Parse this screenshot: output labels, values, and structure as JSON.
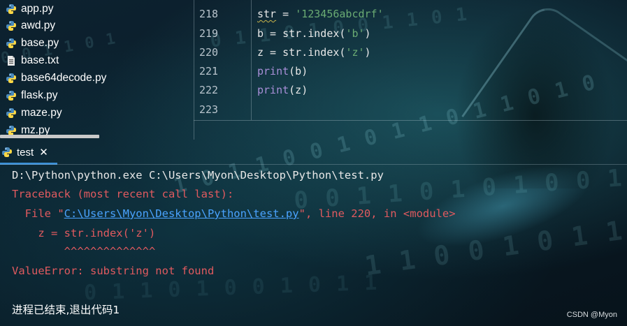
{
  "project_tree": {
    "files": [
      {
        "name": "app.py",
        "icon": "python-file-icon"
      },
      {
        "name": "awd.py",
        "icon": "python-file-icon"
      },
      {
        "name": "base.py",
        "icon": "python-file-icon"
      },
      {
        "name": "base.txt",
        "icon": "text-file-icon"
      },
      {
        "name": "base64decode.py",
        "icon": "python-file-icon"
      },
      {
        "name": "flask.py",
        "icon": "python-file-icon"
      },
      {
        "name": "maze.py",
        "icon": "python-file-icon"
      },
      {
        "name": "mz.py",
        "icon": "python-file-icon"
      }
    ]
  },
  "editor": {
    "lines": [
      {
        "number": "218",
        "var": "str",
        "op": " = ",
        "string": "'123456abcdrf'"
      },
      {
        "number": "219",
        "prefix": "b = str.index(",
        "string": "'b'",
        "suffix": ")"
      },
      {
        "number": "220",
        "prefix": "z = str.index(",
        "string": "'z'",
        "suffix": ")"
      },
      {
        "number": "221",
        "func": "print",
        "args": "(b)"
      },
      {
        "number": "222",
        "func": "print",
        "args": "(z)"
      },
      {
        "number": "223"
      }
    ]
  },
  "run_panel": {
    "tab_label": "test",
    "tab_close": "✕"
  },
  "console": {
    "command": "D:\\Python\\python.exe C:\\Users\\Myon\\Desktop\\Python\\test.py",
    "traceback_header": "Traceback (most recent call last):",
    "file_prefix": "  File \"",
    "file_link": "C:\\Users\\Myon\\Desktop\\Python\\test.py",
    "file_suffix": "\", line 220, in <module>",
    "source_line": "    z = str.index('z')",
    "caret_line": "        ^^^^^^^^^^^^^^",
    "error": "ValueError: substring not found",
    "exit_message": "进程已结束,退出代码1"
  },
  "watermark": "CSDN @Myon⁠",
  "colors": {
    "error_red": "#e05a5f",
    "link_blue": "#4aa3ff",
    "string_green": "#6aab73",
    "function_purple": "#a98fd8",
    "tab_underline": "#3a8fd6"
  }
}
